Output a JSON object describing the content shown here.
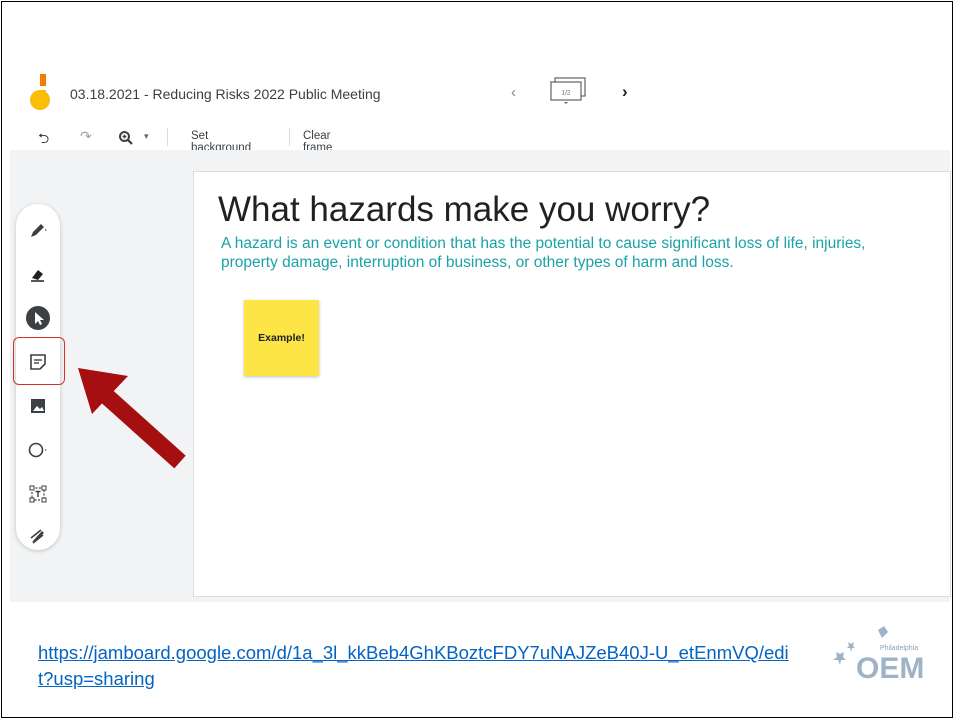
{
  "app": {
    "title": "03.18.2021 - Reducing Risks 2022 Public Meeting",
    "frame_indicator": "1/2"
  },
  "toolbar": {
    "set_background": "Set background",
    "clear_frame": "Clear frame"
  },
  "canvas": {
    "title": "What hazards make you worry?",
    "subtitle": "A hazard is an event or condition that has the potential to cause significant loss of life, injuries, property damage, interruption of business, or other types of harm and loss.",
    "sticky_note": "Example!"
  },
  "tools": [
    "pen-icon",
    "eraser-icon",
    "select-icon",
    "sticky-note-icon",
    "image-icon",
    "circle-icon",
    "text-box-icon",
    "laser-icon"
  ],
  "footer": {
    "link": "https://jamboard.google.com/d/1a_3l_kkBeb4GhKBoztcFDY7uNAJZeB40J-U_etEnmVQ/edit?usp=sharing",
    "logo_text": "OEM",
    "logo_subtext": "Philadelphia"
  },
  "colors": {
    "subtitle": "#1aa2a8",
    "sticky": "#fce545",
    "highlight": "#d93025",
    "arrow": "#a50f0f",
    "link": "#0563c1"
  }
}
